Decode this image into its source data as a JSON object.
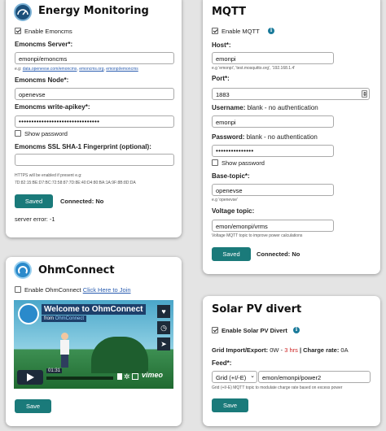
{
  "emoncms": {
    "title": "Energy Monitoring",
    "enable_label": "Enable Emoncms",
    "server_label": "Emoncms Server*:",
    "server_value": "emonpi/emoncms",
    "server_hint_prefix": "e.g:",
    "server_hint_links": [
      "data.openevse.com/emoncms",
      "emoncms.org",
      "emonpi/emoncms"
    ],
    "node_label": "Emoncms Node*:",
    "node_value": "openevse",
    "apikey_label": "Emoncms write-apikey*:",
    "apikey_value": "••••••••••••••••••••••••••••••••",
    "show_password": "Show password",
    "fingerprint_label": "Emoncms SSL SHA-1 Fingerprint (optional):",
    "fingerprint_value": "",
    "https_hint": "HTTPS will be enabled if present e.g:",
    "fingerprint_example": "7D:82:15:BE:D7:BC:72:58:87:7D:8E:40:D4:80:BA:1A:9F:8B:8D:DA",
    "save_button": "Saved",
    "connected": "Connected: No",
    "server_error": "server error: -1"
  },
  "mqtt": {
    "title": "MQTT",
    "enable_label": "Enable MQTT",
    "host_label": "Host*:",
    "host_value": "emonpi",
    "host_hint": "e.g 'emonpi', 'test.mosquitto.org', '192.168.1.4'",
    "port_label": "Port*:",
    "port_value": "1883",
    "username_label": "Username:",
    "username_note": " blank - no authentication",
    "username_value": "emonpi",
    "password_label": "Password:",
    "password_note": " blank - no authentication",
    "password_value": "•••••••••••••••",
    "show_password": "Show password",
    "base_topic_label": "Base-topic*:",
    "base_topic_value": "openevse",
    "base_topic_hint": "e.g 'openevse'",
    "voltage_topic_label": "Voltage topic:",
    "voltage_topic_value": "emon/emonpi/vrms",
    "voltage_topic_hint": "Voltage MQTT topic to improve power calculations",
    "save_button": "Saved",
    "connected": "Connected: No"
  },
  "ohmconnect": {
    "title": "OhmConnect",
    "enable_label": "Enable OhmConnect",
    "join_link": "Click Here to Join",
    "video_title": "Welcome to OhmConnect",
    "video_from": "from",
    "video_channel": "OhmConnect",
    "video_time": "01:31",
    "video_brand": "vimeo",
    "save_button": "Save"
  },
  "solar": {
    "title": "Solar PV divert",
    "enable_label": "Enable Solar PV Divert",
    "grid_label": "Grid Import/Export:",
    "grid_value": "0W",
    "grid_sep": " - ",
    "grid_time": "3 hrs",
    "charge_label": " | Charge rate:",
    "charge_value": "0A",
    "feed_label": "Feed*:",
    "feed_select": "Grid (+I/-E)",
    "feed_value": "emon/emonpi/power2",
    "feed_hint": "Grid (+I/-E) MQTT topic to modulate charge rate based on excess power",
    "save_button": "Save"
  },
  "colors": {
    "accent": "#1a7a7a",
    "link": "#2a5db0",
    "error_red": "#cc2222"
  }
}
